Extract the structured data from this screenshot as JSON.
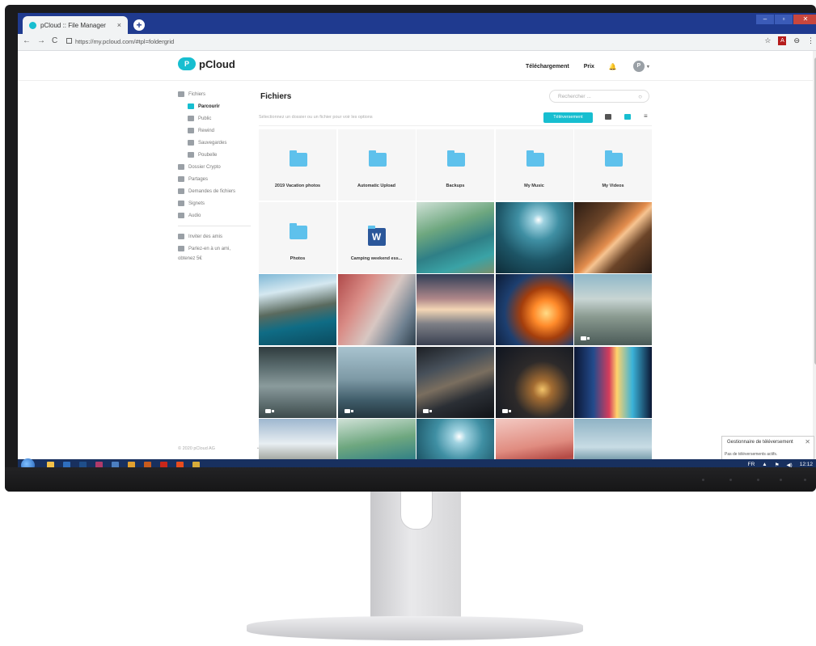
{
  "browser": {
    "tab_title": "pCloud :: File Manager",
    "tab_close": "×",
    "new_tab": "+",
    "url": "https://my.pcloud.com/#tpl=foldergrid",
    "nav_back": "←",
    "nav_forward": "→",
    "nav_reload": "C",
    "window_min": "‒",
    "window_max": "▫",
    "window_close": "✕",
    "menu_icon": "⋮",
    "star_icon": "☆",
    "pdf_icon": "A",
    "account_icon": "⊖"
  },
  "header": {
    "brand": "pCloud",
    "logo_letter": "P",
    "download_label": "Téléchargement",
    "price_label": "Prix",
    "bell_icon": "🔔",
    "avatar_letter": "P",
    "avatar_caret": "▾"
  },
  "sidebar": {
    "files": "Fichiers",
    "sub_items": [
      {
        "label": "Parcourir",
        "active": true
      },
      {
        "label": "Public"
      },
      {
        "label": "Rewind"
      },
      {
        "label": "Sauvegardes"
      },
      {
        "label": "Poubelle"
      }
    ],
    "items": [
      {
        "label": "Dossier Crypto"
      },
      {
        "label": "Partages"
      },
      {
        "label": "Demandes de fichiers"
      },
      {
        "label": "Signets"
      },
      {
        "label": "Audio"
      }
    ],
    "invite": "Inviter des amis",
    "refer_1": "Parlez-en à un ami,",
    "refer_2": "obtenez 5€",
    "footer": "© 2020 pCloud AG",
    "footer_more": "•••"
  },
  "main": {
    "title": "Fichiers",
    "search_placeholder": "Rechercher ...",
    "search_icon": "○",
    "hint": "Sélectionnez un dossier ou un fichier pour voir les options",
    "upload_button": "Téléversement",
    "sort_icon": "≡",
    "folders": [
      "2019 Vacation photos",
      "Automatic Upload",
      "Backups",
      "My Music",
      "My Videos",
      "Photos"
    ],
    "doc": {
      "name": "Camping weekend ess...",
      "letter": "W"
    },
    "photos": [
      {
        "gradient": "linear-gradient(160deg,#cfe1d6 0%,#6ea77f 35%,#2f7f86 60%,#3aa3a6 80%,#7a8f6b 100%)",
        "video": false
      },
      {
        "gradient": "radial-gradient(circle at 55% 25%,#ffffff 0%,#9fd2e0 8%,#3f8fa3 30%,#1d5566 60%,#0e2c38 100%)",
        "video": false
      },
      {
        "gradient": "linear-gradient(135deg,#2b1c14 0%,#6b4428 30%,#e38d4d 50%,#f6c491 55%,#6b4428 70%,#2b1c14 100%)",
        "video": false
      },
      {
        "gradient": "linear-gradient(170deg,#7fb8d6 0%,#d5e8f0 25%,#5a6a5e 50%,#0f6c85 70%,#0b4a5e 100%)",
        "video": false
      },
      {
        "gradient": "linear-gradient(120deg,#b04a4a 0%,#d98c86 30%,#d8c7c2 55%,#6e8090 80%,#2e3f4c 100%)",
        "video": false
      },
      {
        "gradient": "linear-gradient(180deg,#2f3e57 0%,#b0888a 35%,#f3d6b5 50%,#7d7f86 70%,#3a4050 100%)",
        "video": false
      },
      {
        "gradient": "radial-gradient(circle at 65% 55%,#ffdc86 0%,#ff8a2a 20%,#a43e0c 40%,#1d3f70 65%,#0d1b35 100%)",
        "video": false
      },
      {
        "gradient": "linear-gradient(180deg,#8fb8c9 0%,#c8d5d3 35%,#8a9a90 60%,#4a5a57 100%)",
        "video": true
      },
      {
        "gradient": "linear-gradient(180deg,#2f3b3e 0%,#5d6f71 30%,#8a9b9c 55%,#3c4a4c 100%)",
        "video": true
      },
      {
        "gradient": "linear-gradient(180deg,#a8c3cf 0%,#7e9aa6 45%,#405d6a 75%,#23353e 100%)",
        "video": true
      },
      {
        "gradient": "linear-gradient(160deg,#1c1f24 0%,#47505a 30%,#7a6e5f 50%,#2b2f35 70%,#101216 100%)",
        "video": true
      },
      {
        "gradient": "radial-gradient(circle at 60% 60%,#f3c46a 0%,#a36c32 15%,#2d2a2a 45%,#0f1520 100%)",
        "video": true
      },
      {
        "gradient": "linear-gradient(90deg,#0b1633 0%,#234b8c 25%,#d63b5b 45%,#ffd36b 55%,#3bb3d9 75%,#0b1633 100%)",
        "video": false
      },
      {
        "gradient": "linear-gradient(180deg,#9eb7cf 0%,#e8eef2 35%,#9a9f98 60%,#4b6b88 100%)",
        "video": false
      },
      {
        "gradient": "linear-gradient(170deg,#cfe1d6 0%,#6ea77f 35%,#2f7f86 65%,#6f8f6b 100%)",
        "video": false
      },
      {
        "gradient": "radial-gradient(circle at 55% 25%,#ffffff 0%,#9fd2e0 10%,#3f8fa3 35%,#1d5566 70%)",
        "video": false
      },
      {
        "gradient": "linear-gradient(170deg,#f3c9c2 0%,#e08c80 40%,#b44a45 60%,#9fb2c0 100%)",
        "video": false
      },
      {
        "gradient": "linear-gradient(180deg,#8fb3c5 0%,#c8dce4 40%,#3f6f84 70%,#23495b 100%)",
        "video": false
      }
    ]
  },
  "upload_manager": {
    "title": "Gestionnaire de téléversement",
    "status": "Pas de téléversements actifs.",
    "close": "✕"
  },
  "taskbar": {
    "lang": "FR",
    "time": "12:12",
    "arrow": "▲",
    "flag": "⚑",
    "volume": "◀)"
  }
}
